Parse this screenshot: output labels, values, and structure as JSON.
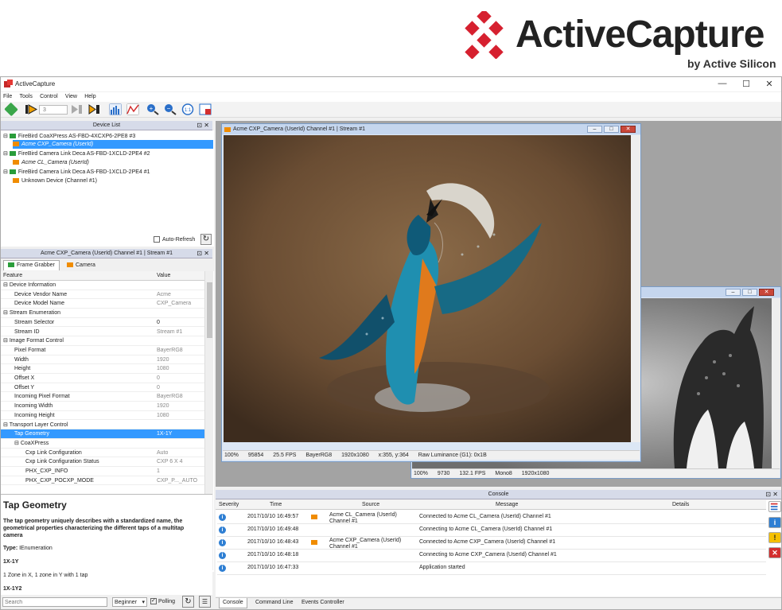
{
  "brand": {
    "name": "ActiveCapture",
    "sub": "by Active Silicon",
    "color": "#d6202f"
  },
  "app": {
    "title": "ActiveCapture"
  },
  "window_controls": {
    "min": "—",
    "max": "☐",
    "close": "✕"
  },
  "menu": [
    "File",
    "Tools",
    "Control",
    "View",
    "Help"
  ],
  "toolbar": {
    "spin_value": "3"
  },
  "device_list": {
    "title": "Device List",
    "items": [
      {
        "label": "FireBird CoaXPress AS-FBD-4XCXP6-2PE8 #3",
        "level": 0,
        "icon": "green"
      },
      {
        "label": "Acme CXP_Camera (UserId)",
        "level": 1,
        "icon": "orange",
        "selected": true
      },
      {
        "label": "FireBird Camera Link Deca AS-FBD-1XCLD-2PE4 #2",
        "level": 0,
        "icon": "green"
      },
      {
        "label": "Acme CL_Camera (UserId)",
        "level": 1,
        "icon": "orange"
      },
      {
        "label": "FireBird Camera Link Deca AS-FBD-1XCLD-2PE4 #1",
        "level": 0,
        "icon": "green"
      },
      {
        "label": "Unknown Device (Channel #1)",
        "level": 1,
        "icon": "orange"
      }
    ],
    "auto_refresh": "Auto-Refresh"
  },
  "features": {
    "title": "Acme CXP_Camera (UserId) Channel #1 | Stream #1",
    "tabs": [
      "Frame Grabber",
      "Camera"
    ],
    "col_feature": "Feature",
    "col_value": "Value",
    "rows": [
      {
        "name": "Device Information",
        "value": "",
        "level": 0
      },
      {
        "name": "Device Vendor Name",
        "value": "Acme",
        "level": 1
      },
      {
        "name": "Device Model Name",
        "value": "CXP_Camera",
        "level": 1
      },
      {
        "name": "Stream Enumeration",
        "value": "",
        "level": 0
      },
      {
        "name": "Stream Selector",
        "value": "0",
        "level": 1,
        "dark": true
      },
      {
        "name": "Stream ID",
        "value": "Stream #1",
        "level": 1
      },
      {
        "name": "Image Format Control",
        "value": "",
        "level": 0
      },
      {
        "name": "Pixel Format",
        "value": "BayerRG8",
        "level": 1
      },
      {
        "name": "Width",
        "value": "1920",
        "level": 1
      },
      {
        "name": "Height",
        "value": "1080",
        "level": 1
      },
      {
        "name": "Offset X",
        "value": "0",
        "level": 1
      },
      {
        "name": "Offset Y",
        "value": "0",
        "level": 1
      },
      {
        "name": "Incoming Pixel Format",
        "value": "BayerRG8",
        "level": 1
      },
      {
        "name": "Incoming Width",
        "value": "1920",
        "level": 1
      },
      {
        "name": "Incoming Height",
        "value": "1080",
        "level": 1
      },
      {
        "name": "Transport Layer Control",
        "value": "",
        "level": 0
      },
      {
        "name": "Tap Geometry",
        "value": "1X-1Y",
        "level": 1,
        "selected": true
      },
      {
        "name": "CoaXPress",
        "value": "",
        "level": 1
      },
      {
        "name": "Cxp Link Configuration",
        "value": "Auto",
        "level": 2
      },
      {
        "name": "Cxp Link Configuration Status",
        "value": "CXP 6 X 4",
        "level": 2
      },
      {
        "name": "PHX_CXP_INFO",
        "value": "1",
        "level": 2
      },
      {
        "name": "PHX_CXP_POCXP_MODE",
        "value": "CXP_P..._AUTO",
        "level": 2
      }
    ]
  },
  "description": {
    "title": "Tap Geometry",
    "body": "The tap geometry uniquely describes with a standardized name, the geometrical properties characterizing the different taps of a multitap camera",
    "type_label": "Type:",
    "type_value": "IEnumeration",
    "opt1": "1X-1Y",
    "opt1_desc": "1 Zone in X, 1 zone in Y with 1 tap",
    "opt2": "1X-1Y2"
  },
  "bottom": {
    "search_placeholder": "Search",
    "level": "Beginner",
    "polling": "Polling"
  },
  "main_window": {
    "title": "Acme CXP_Camera (UserId) Channel #1 | Stream #1",
    "status": [
      "100%",
      "95854",
      "25.5 FPS",
      "BayerRG8",
      "1920x1080",
      "x:355, y:364",
      "Raw Luminance (G1): 0x1B"
    ]
  },
  "second_window": {
    "status": [
      "100%",
      "9730",
      "132.1 FPS",
      "Mono8",
      "1920x1080"
    ]
  },
  "console": {
    "title": "Console",
    "columns": [
      "Severity",
      "Time",
      "Source",
      "Message",
      "Details"
    ],
    "rows": [
      {
        "time": "2017/10/10 16:49:57",
        "source": "Acme CL_Camera (UserId) Channel #1",
        "message": "Connected to Acme CL_Camera (UserId) Channel #1",
        "cam": true
      },
      {
        "time": "2017/10/10 16:49:48",
        "source": "",
        "message": "Connecting to Acme CL_Camera (UserId) Channel #1",
        "cam": false
      },
      {
        "time": "2017/10/10 16:48:43",
        "source": "Acme CXP_Camera (UserId) Channel #1",
        "message": "Connected to Acme CXP_Camera (UserId) Channel #1",
        "cam": true
      },
      {
        "time": "2017/10/10 16:48:18",
        "source": "",
        "message": "Connecting to Acme CXP_Camera (UserId) Channel #1",
        "cam": false
      },
      {
        "time": "2017/10/10 16:47:33",
        "source": "",
        "message": "Application started",
        "cam": false
      }
    ],
    "tabs": [
      "Console",
      "Command Line",
      "Events Controller"
    ]
  }
}
